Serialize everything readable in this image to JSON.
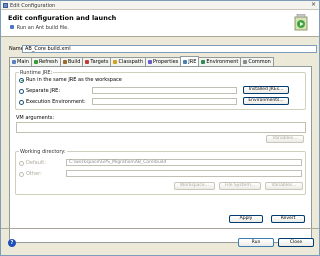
{
  "window": {
    "title": "Edit Configuration"
  },
  "banner": {
    "title": "Edit configuration and launch",
    "subtitle": "Run an Ant build file."
  },
  "name": {
    "label": "Name:",
    "value": "AB_Core build.xml"
  },
  "tabs": [
    {
      "label": "Main",
      "icon": "main-icon",
      "color": "#5b7fbf"
    },
    {
      "label": "Refresh",
      "icon": "refresh-icon",
      "color": "#3b9a3b"
    },
    {
      "label": "Build",
      "icon": "build-icon",
      "color": "#9c6b2a"
    },
    {
      "label": "Targets",
      "icon": "targets-icon",
      "color": "#c23b3b"
    },
    {
      "label": "Classpath",
      "icon": "classpath-icon",
      "color": "#d6a020"
    },
    {
      "label": "Properties",
      "icon": "properties-icon",
      "color": "#6a5acd"
    },
    {
      "label": "JRE",
      "icon": "jre-icon",
      "color": "#4c7fb8"
    },
    {
      "label": "Environment",
      "icon": "environment-icon",
      "color": "#2e8b57"
    },
    {
      "label": "Common",
      "icon": "common-icon",
      "color": "#8a8a8a"
    }
  ],
  "active_tab": "JRE",
  "runtime": {
    "label": "Runtime JRE:",
    "options": [
      {
        "label": "Run in the same JRE as the workspace",
        "selected": true
      },
      {
        "label": "Separate JRE:",
        "selected": false
      },
      {
        "label": "Execution Environment:",
        "selected": false
      }
    ],
    "installed_btn": "Installed JREs...",
    "environments_btn": "Environments..."
  },
  "vm": {
    "label": "VM arguments:",
    "variables_btn": "Variables..."
  },
  "workdir": {
    "label": "Working directory:",
    "default_label": "Default:",
    "default_value": "C:\\workspace\\GPS_Migration\\AB_Core\\build",
    "other_label": "Other:",
    "workspace_btn": "Workspace...",
    "filesystem_btn": "File System...",
    "variables_btn": "Variables..."
  },
  "actions": {
    "apply": "Apply",
    "revert": "Revert"
  },
  "footer": {
    "run": "Run",
    "close": "Close",
    "help": "?"
  }
}
